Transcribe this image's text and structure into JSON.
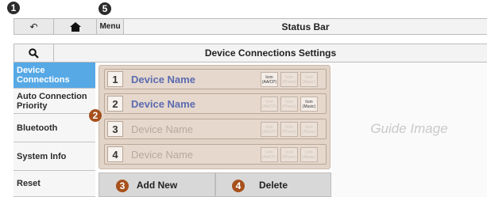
{
  "callouts": [
    "1",
    "2",
    "3",
    "4",
    "5"
  ],
  "status_bar": {
    "back_icon": "back-arrow-icon",
    "home_icon": "home-icon",
    "menu_label": "Menu",
    "title": "Status Bar"
  },
  "header": {
    "search_icon": "search-icon",
    "title": "Device Connections Settings"
  },
  "sidebar": {
    "items": [
      {
        "label": "Device\nConnections",
        "active": true
      },
      {
        "label": "Auto Connection\nPriority",
        "active": false
      },
      {
        "label": "Bluetooth",
        "active": false
      },
      {
        "label": "System Info",
        "active": false
      },
      {
        "label": "Reset",
        "active": false
      }
    ]
  },
  "devices": [
    {
      "num": "1",
      "name": "Device Name",
      "icons": [
        "Icon\n(AA/CP)",
        "Icon\n(Phone)",
        "Icon\n(Music)"
      ],
      "icons_on": [
        true,
        false,
        false
      ]
    },
    {
      "num": "2",
      "name": "Device Name",
      "icons": [
        "Icon\n(AA/CP)",
        "Icon\n(Phone)",
        "Icon\n(Music)"
      ],
      "icons_on": [
        false,
        false,
        true
      ]
    },
    {
      "num": "3",
      "name": "Device Name",
      "icons": [
        "Icon\n(AA/CP)",
        "Icon\n(Phone)",
        "Icon\n(Music)"
      ],
      "icons_on": [
        false,
        false,
        false
      ]
    },
    {
      "num": "4",
      "name": "Device Name",
      "icons": [
        "Icon\n(AA/CP)",
        "Icon\n(Phone)",
        "Icon\n(Music)"
      ],
      "icons_on": [
        false,
        false,
        false
      ]
    }
  ],
  "buttons": {
    "add_new": "Add New",
    "delete": "Delete"
  },
  "guide": {
    "text": "Guide Image"
  },
  "colors": {
    "active_sidebar": "#57a9e6",
    "device_name": "#5b6bb0",
    "callout_brown": "#a6501c",
    "callout_dark": "#2b2b2b"
  }
}
